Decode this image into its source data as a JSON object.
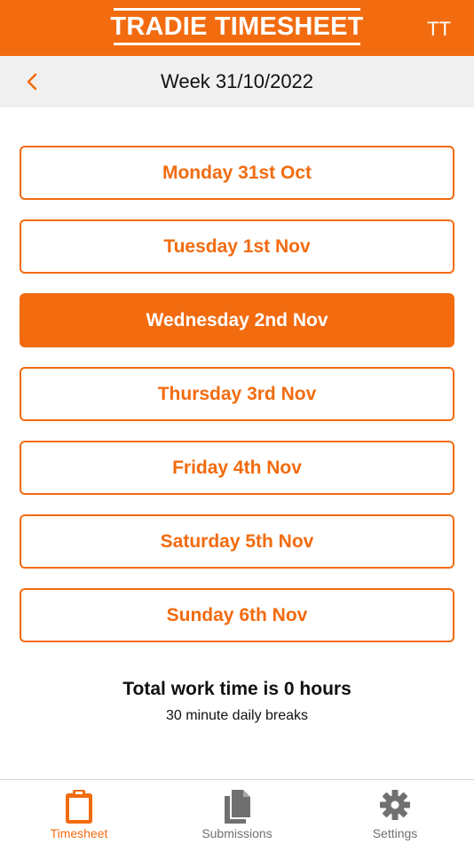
{
  "header": {
    "logo_text": "TRADIE TIMESHEET",
    "avatar_initials": "TT"
  },
  "week": {
    "back_icon": "chevron-left-icon",
    "title": "Week 31/10/2022"
  },
  "days": [
    {
      "label": "Monday 31st Oct",
      "selected": false
    },
    {
      "label": "Tuesday 1st Nov",
      "selected": false
    },
    {
      "label": "Wednesday 2nd Nov",
      "selected": true
    },
    {
      "label": "Thursday 3rd Nov",
      "selected": false
    },
    {
      "label": "Friday 4th Nov",
      "selected": false
    },
    {
      "label": "Saturday 5th Nov",
      "selected": false
    },
    {
      "label": "Sunday 6th Nov",
      "selected": false
    }
  ],
  "summary": {
    "total": "Total work time is 0 hours",
    "breaks": "30 minute daily breaks"
  },
  "nav": {
    "items": [
      {
        "label": "Timesheet",
        "icon": "clipboard-icon",
        "active": true
      },
      {
        "label": "Submissions",
        "icon": "documents-icon",
        "active": false
      },
      {
        "label": "Settings",
        "icon": "gear-icon",
        "active": false
      }
    ]
  },
  "colors": {
    "accent": "#f26b0f",
    "week_bar": "#f0f0f0",
    "nav_inactive": "#707070"
  }
}
